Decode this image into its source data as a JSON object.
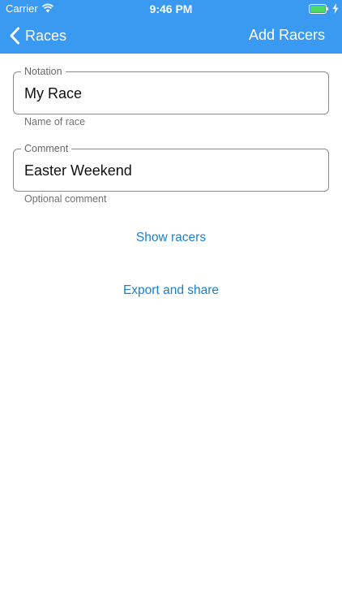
{
  "status_bar": {
    "carrier": "Carrier",
    "time": "9:46 PM",
    "icons": [
      "wifi-icon",
      "battery-icon",
      "charging-bolt-icon"
    ]
  },
  "nav": {
    "back_label": "Races",
    "back_icon": "chevron-left-icon",
    "action_label": "Add Racers",
    "bar_color": "#3a99f0"
  },
  "form": {
    "notation": {
      "label": "Notation",
      "value": "My Race",
      "helper": "Name of race"
    },
    "comment": {
      "label": "Comment",
      "value": "Easter Weekend",
      "helper": "Optional comment"
    }
  },
  "actions": {
    "show_racers": "Show racers",
    "export_share": "Export and share",
    "link_color": "#1a7fd0"
  }
}
